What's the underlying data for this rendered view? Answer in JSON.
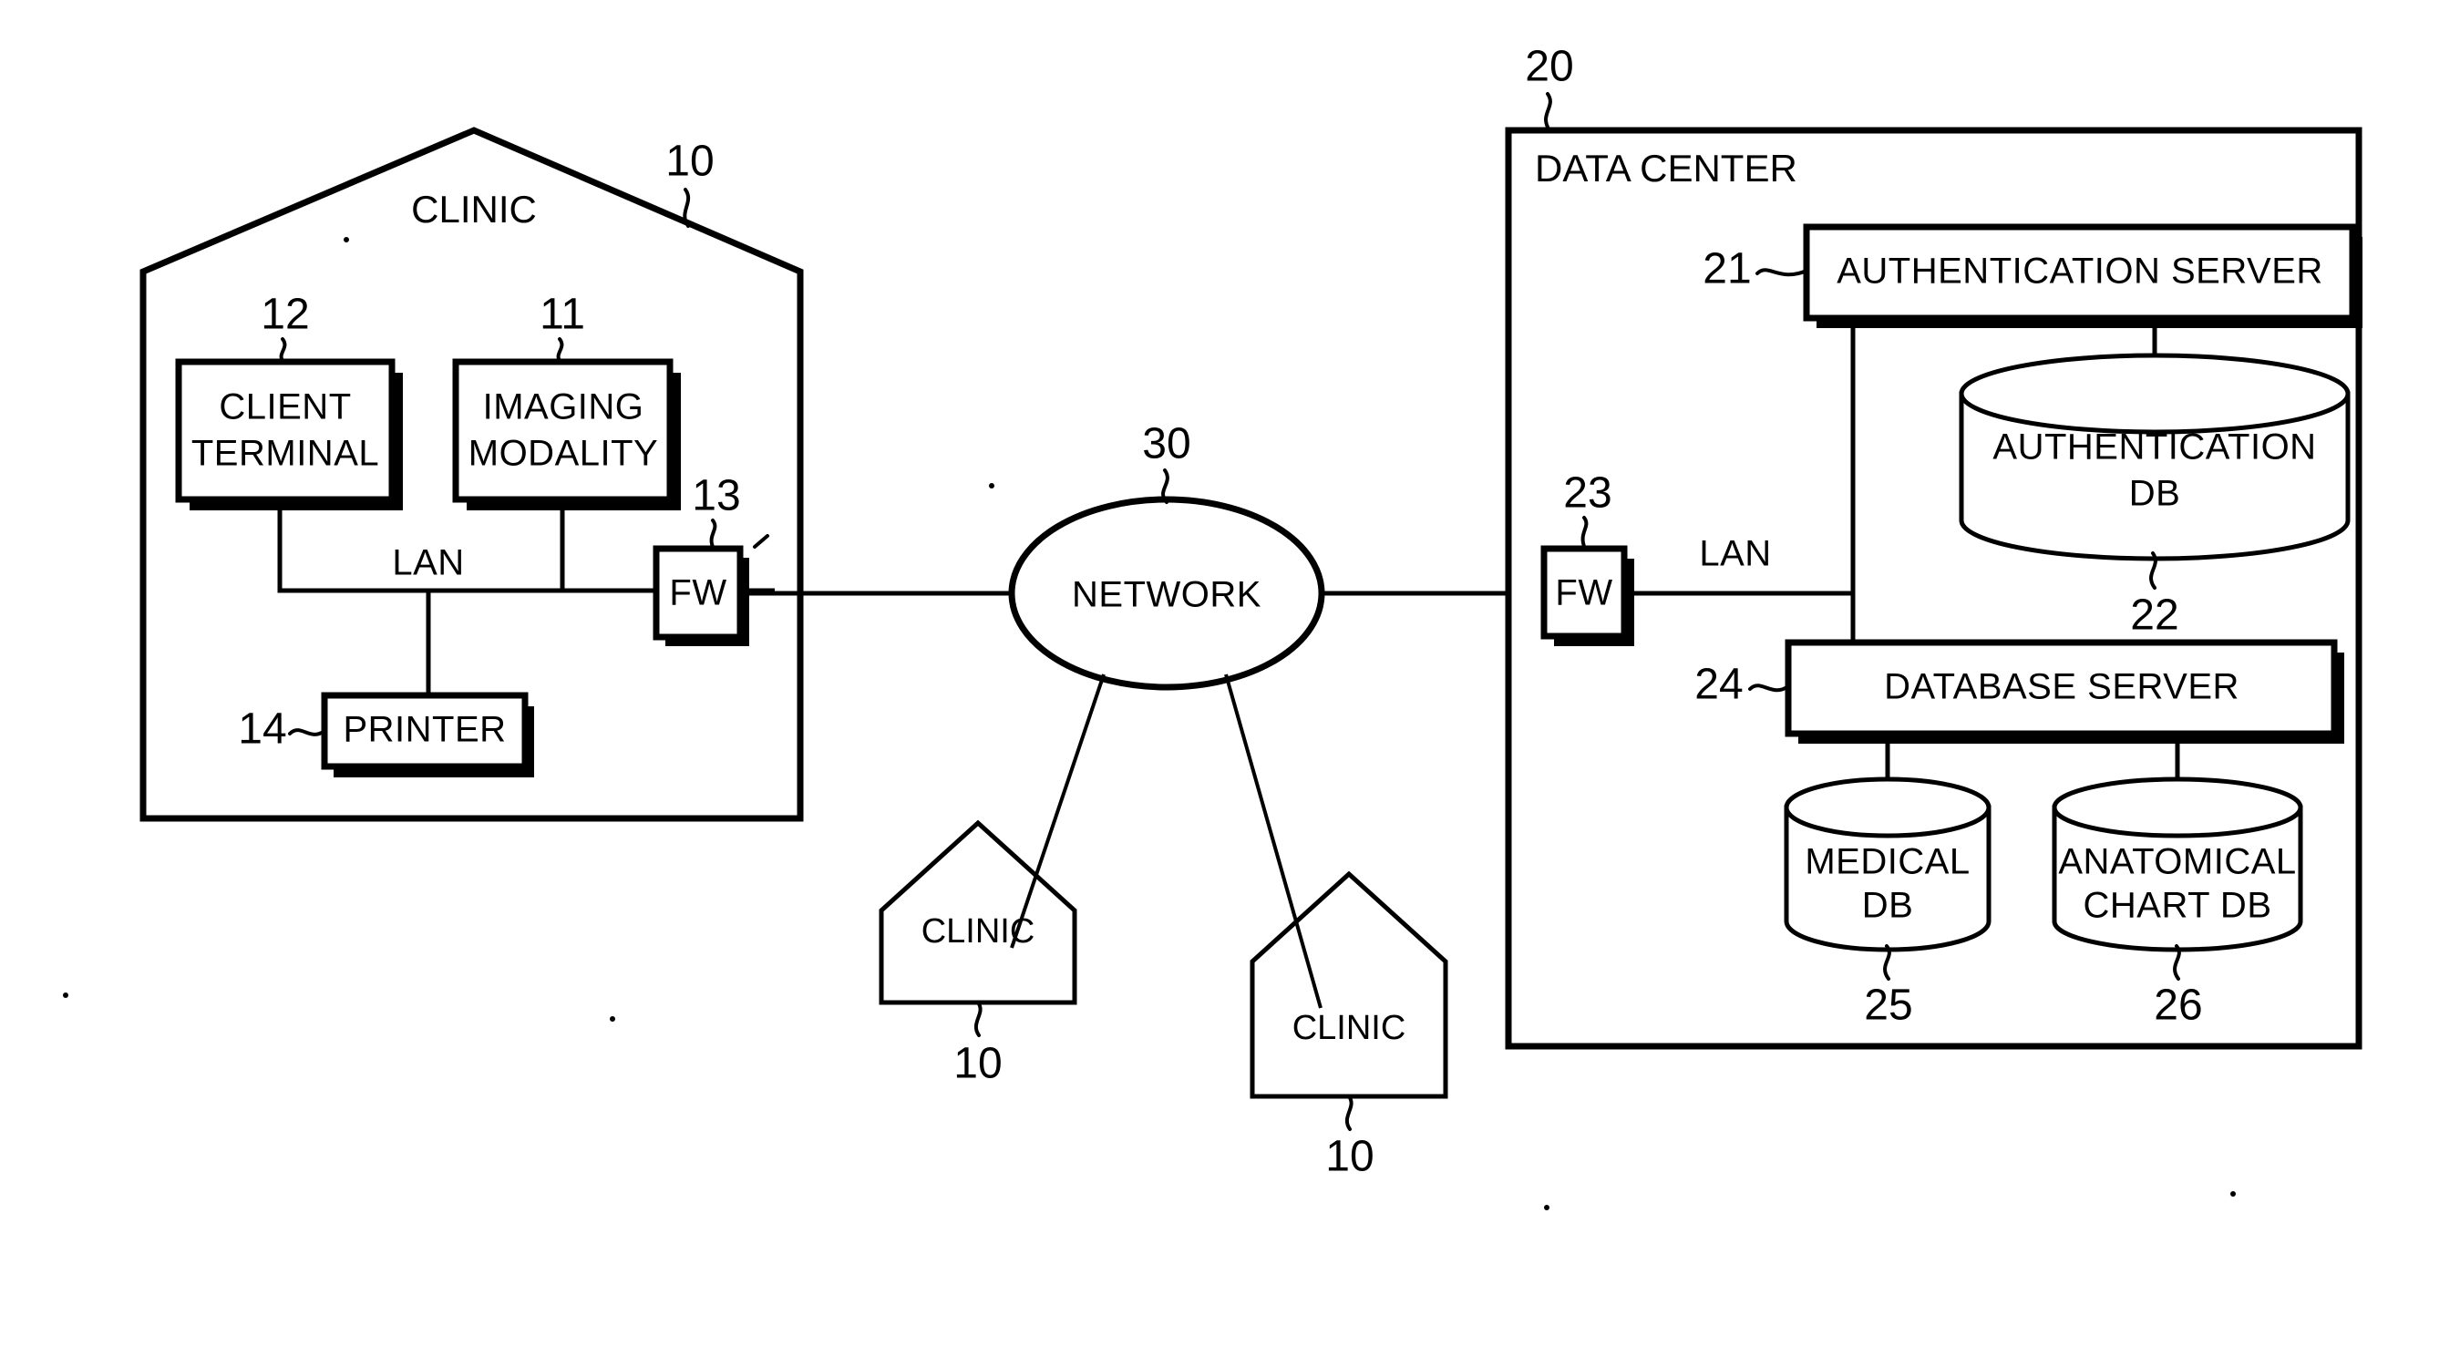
{
  "figure": {
    "type": "patent-system-diagram",
    "background": "#ffffff",
    "ink": "#000000"
  },
  "clinic_main": {
    "title": "CLINIC",
    "ref": "10",
    "client_terminal": {
      "line1": "CLIENT",
      "line2": "TERMINAL",
      "ref": "12"
    },
    "imaging_modality": {
      "line1": "IMAGING",
      "line2": "MODALITY",
      "ref": "11"
    },
    "firewall": {
      "label": "FW",
      "ref": "13"
    },
    "printer": {
      "label": "PRINTER",
      "ref": "14"
    },
    "lan_label": "LAN"
  },
  "network": {
    "label": "NETWORK",
    "ref": "30"
  },
  "other_clinics": [
    {
      "label": "CLINIC",
      "ref": "10"
    },
    {
      "label": "CLINIC",
      "ref": "10"
    }
  ],
  "data_center": {
    "title": "DATA CENTER",
    "ref": "20",
    "lan_label": "LAN",
    "firewall": {
      "label": "FW",
      "ref": "23"
    },
    "authentication_server": {
      "label": "AUTHENTICATION SERVER",
      "ref": "21"
    },
    "authentication_db": {
      "line1": "AUTHENTICATION",
      "line2": "DB",
      "ref": "22"
    },
    "database_server": {
      "label": "DATABASE SERVER",
      "ref": "24"
    },
    "medical_db": {
      "line1": "MEDICAL",
      "line2": "DB",
      "ref": "25"
    },
    "anatomical_chart_db": {
      "line1": "ANATOMICAL",
      "line2": "CHART DB",
      "ref": "26"
    }
  }
}
